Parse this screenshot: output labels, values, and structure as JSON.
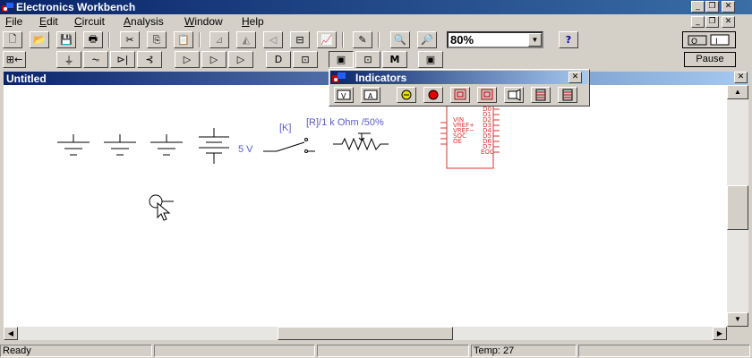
{
  "app": {
    "title": "Electronics Workbench"
  },
  "menu": [
    "File",
    "Edit",
    "Circuit",
    "Analysis",
    "Window",
    "Help"
  ],
  "menu_underline": [
    "F",
    "E",
    "C",
    "A",
    "W",
    "H"
  ],
  "zoom": {
    "value": "80%"
  },
  "pause_label": "Pause",
  "document": {
    "title": "Untitled"
  },
  "indicators": {
    "title": "Indicators"
  },
  "circuit": {
    "battery_label": "5 V",
    "switch_label": "[K]",
    "pot_label": "[R]/1 k Ohm /50%",
    "ic_left_pins": [
      "VIN",
      "VREF+",
      "VREF−",
      "SOC",
      "OE"
    ],
    "ic_right_pins": [
      "D0",
      "D1",
      "D2",
      "D3",
      "D4",
      "D5",
      "D6",
      "D7",
      "EOC"
    ]
  },
  "status": {
    "text": "Ready",
    "temp": "Temp:  27"
  },
  "colors": {
    "title_bar": "#0a246a",
    "circuit_blue": "#5b5bd0",
    "ic_red": "#e03030"
  }
}
